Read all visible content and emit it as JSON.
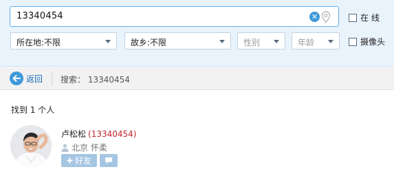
{
  "search": {
    "value": "13340454"
  },
  "options": {
    "online_label": "在 线",
    "camera_label": "摄像头"
  },
  "filters": {
    "location": "所在地:不限",
    "hometown": "故乡:不限",
    "gender": "性别",
    "age": "年龄"
  },
  "nav": {
    "back_label": "返回",
    "search_crumb": "搜索：  13340454"
  },
  "results": {
    "count_text": "找到 1 个人",
    "people": [
      {
        "name": "卢松松",
        "qq": "(13340454)",
        "location": "北京 怀柔",
        "add_friend_label": "好友"
      }
    ]
  },
  "colors": {
    "accent": "#3f99d9",
    "header_bg": "#e9f3fc",
    "qq_number": "#c0242e"
  },
  "icons": [
    "clear-icon",
    "location-pin-icon",
    "back-arrow-icon",
    "person-icon",
    "plus-icon",
    "chat-bubble-icon"
  ]
}
